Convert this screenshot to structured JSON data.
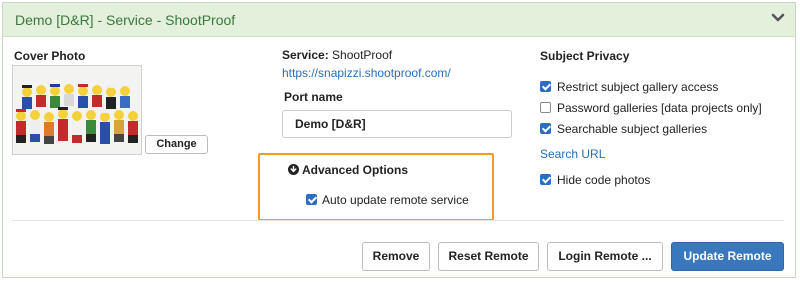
{
  "header": {
    "title": "Demo [D&R] - Service - ShootProof",
    "chevron_icon": "chevron-down-icon"
  },
  "cover": {
    "label": "Cover Photo",
    "change_button": "Change"
  },
  "service": {
    "label": "Service:",
    "name": "ShootProof",
    "url": "https://snapizzi.shootproof.com/"
  },
  "port": {
    "label": "Port name",
    "value": "Demo [D&R]"
  },
  "advanced": {
    "title": "Advanced Options",
    "icon": "arrow-down-circle-icon",
    "auto_update_label": "Auto update remote service",
    "auto_update_checked": true,
    "highlight_color": "#f39a2d"
  },
  "privacy": {
    "title": "Subject Privacy",
    "options": [
      {
        "label": "Restrict subject gallery access",
        "checked": true
      },
      {
        "label": "Password galleries [data projects only]",
        "checked": false
      },
      {
        "label": "Searchable subject galleries",
        "checked": true
      }
    ],
    "search_url_label": "Search URL",
    "hide_codes_label": "Hide code photos",
    "hide_codes_checked": true
  },
  "actions": {
    "remove": "Remove",
    "reset_remote": "Reset Remote",
    "login_remote": "Login Remote ...",
    "update_remote": "Update Remote"
  },
  "colors": {
    "header_bg": "#e3f1dc",
    "header_text": "#3c763d",
    "link": "#2a6fb5",
    "primary": "#3a78be"
  }
}
